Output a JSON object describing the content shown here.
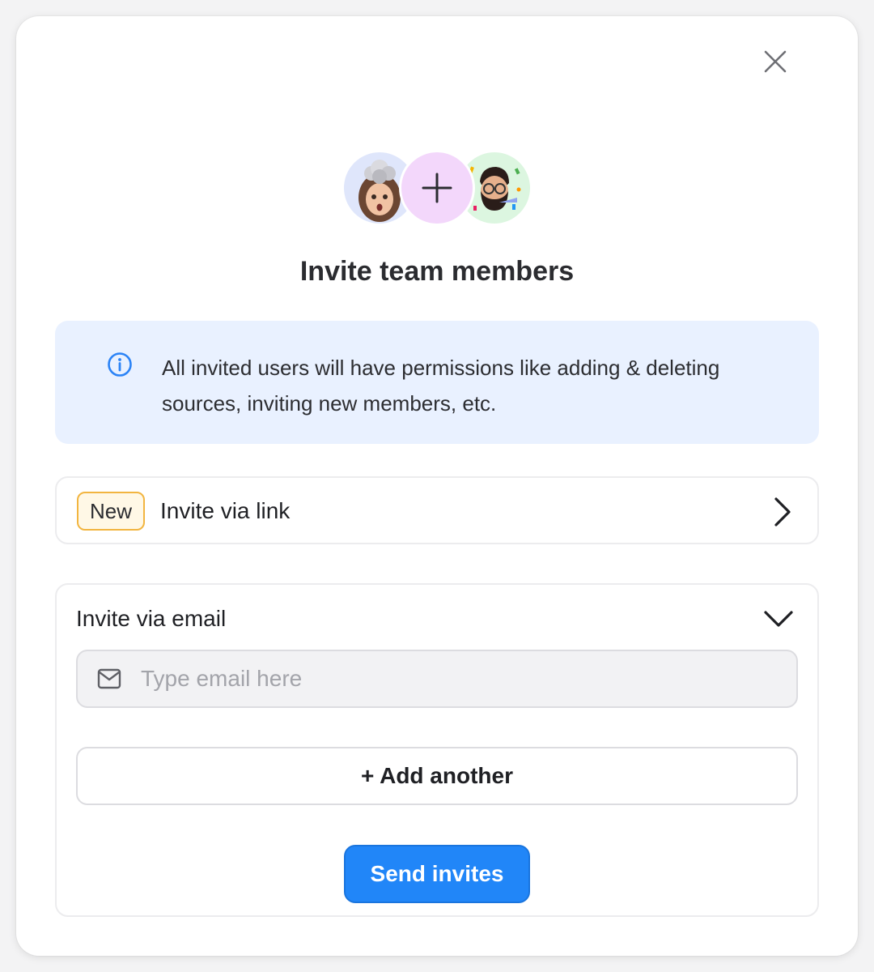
{
  "modal": {
    "title": "Invite team members",
    "close_icon": "close-icon"
  },
  "avatars": [
    {
      "name": "avatar-woman-memoji",
      "bg": "#dfe6fb"
    },
    {
      "name": "add-member-plus-icon",
      "bg": "#f3d7fb"
    },
    {
      "name": "avatar-man-memoji",
      "bg": "#dcf6e0"
    }
  ],
  "info": {
    "icon": "info-icon",
    "text": "All invited users will have permissions like adding & deleting sources, inviting new members, etc.",
    "bg": "#e9f1ff",
    "icon_color": "#2b83f6"
  },
  "invite_link": {
    "badge": "New",
    "label": "Invite via link",
    "icon": "chevron-right-icon"
  },
  "invite_email": {
    "label": "Invite via email",
    "icon": "chevron-down-icon",
    "input_icon": "mail-icon",
    "placeholder": "Type email here",
    "value": "",
    "add_label": "+ Add another",
    "send_label": "Send invites",
    "accent": "#2186f8"
  }
}
